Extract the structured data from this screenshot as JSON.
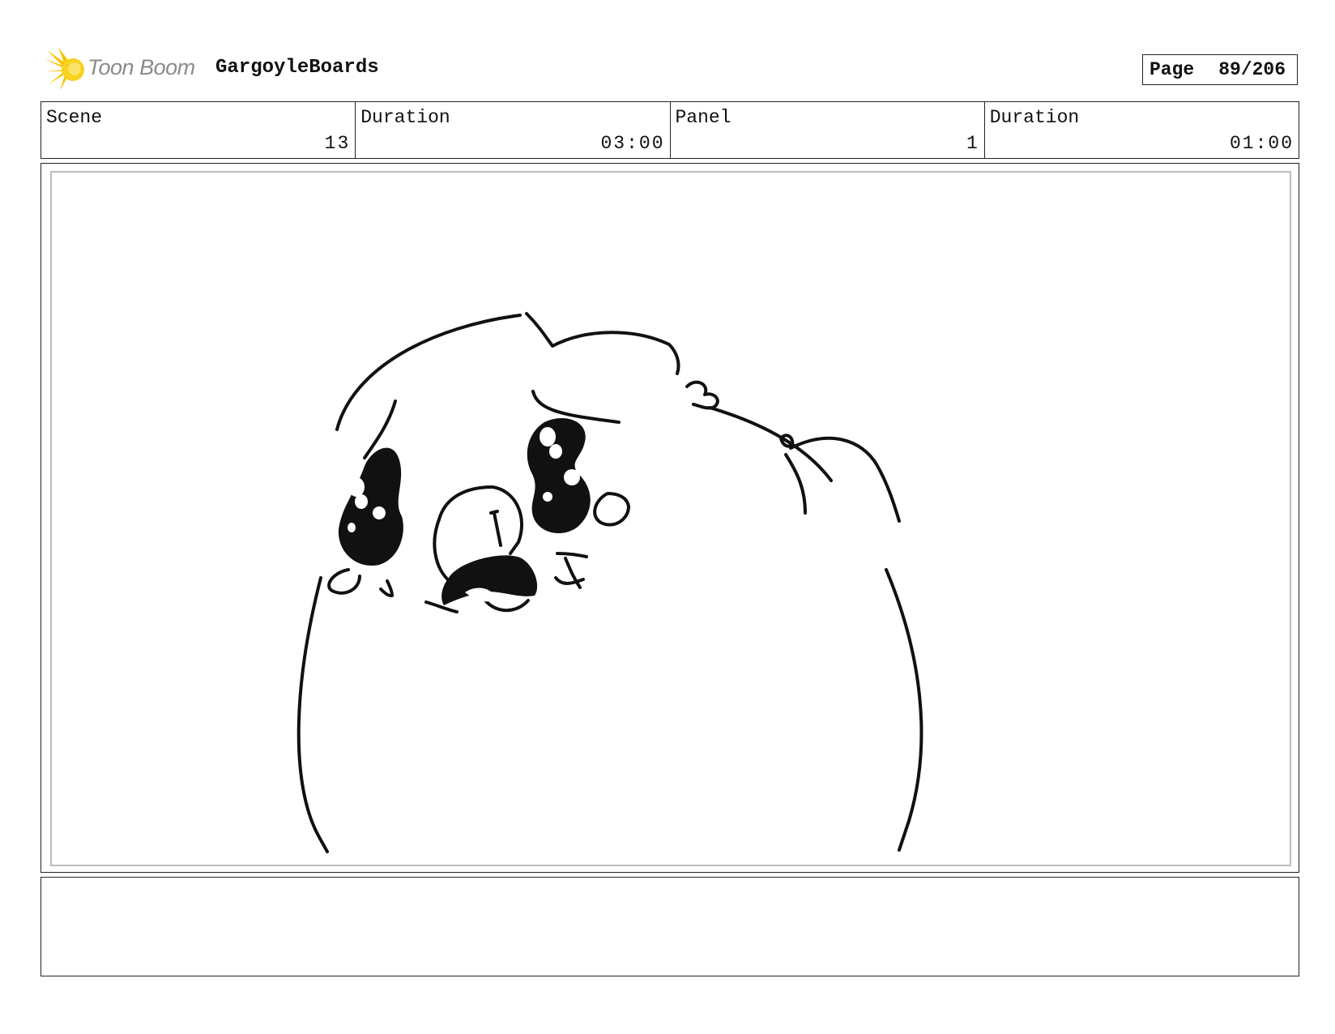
{
  "header": {
    "logo_text": "Toon Boom",
    "project_title": "GargoyleBoards",
    "page_label": "Page",
    "page_number": "89/206"
  },
  "info": {
    "scene_label": "Scene",
    "scene_value": "13",
    "scene_duration_label": "Duration",
    "scene_duration_value": "03:00",
    "panel_label": "Panel",
    "panel_value": "1",
    "panel_duration_label": "Duration",
    "panel_duration_value": "01:00"
  },
  "notes": {
    "text": ""
  }
}
